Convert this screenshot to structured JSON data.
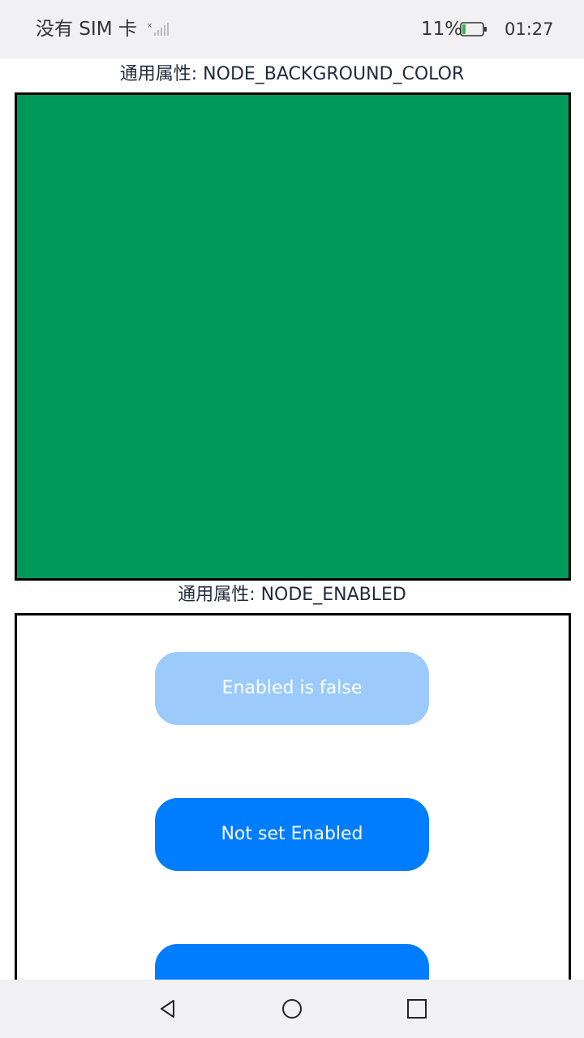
{
  "status_bar": {
    "carrier": "没有 SIM 卡",
    "battery": "11%",
    "time": "01:27"
  },
  "sections": {
    "background": {
      "title": "通用属性: NODE_BACKGROUND_COLOR",
      "color": "#00995c"
    },
    "enabled": {
      "title": "通用属性: NODE_ENABLED",
      "buttons": [
        {
          "label": "Enabled is false",
          "color": "#9ccbfb",
          "enabled": false
        },
        {
          "label": "Not set Enabled",
          "color": "#007dfe",
          "enabled": true
        },
        {
          "label": "",
          "color": "#007dfe",
          "enabled": true
        }
      ]
    }
  },
  "nav": {
    "icons": [
      "back-icon",
      "home-icon",
      "recent-apps-icon"
    ]
  }
}
